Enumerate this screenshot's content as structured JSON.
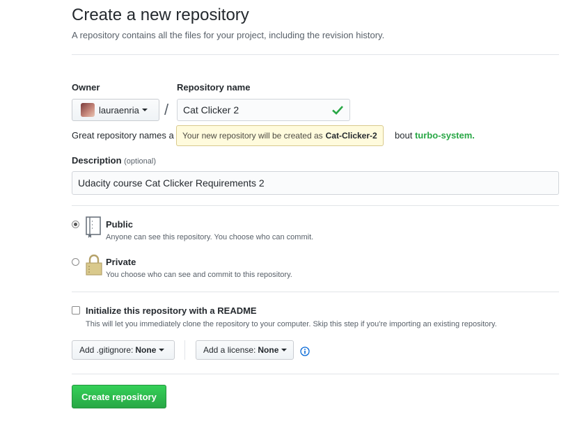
{
  "header": {
    "title": "Create a new repository",
    "subtitle": "A repository contains all the files for your project, including the revision history."
  },
  "owner": {
    "label": "Owner",
    "value": "lauraenria"
  },
  "repo": {
    "label": "Repository name",
    "value": "Cat Clicker 2",
    "separator": "/"
  },
  "hint": {
    "prefix": "Great repository names a",
    "suffix_pre": "bout",
    "suggestion": "turbo-system."
  },
  "tooltip": {
    "text": "Your new repository will be created as",
    "name": "Cat-Clicker-2"
  },
  "description": {
    "label": "Description",
    "optional": "(optional)",
    "value": "Udacity course Cat Clicker Requirements 2"
  },
  "visibility": {
    "public": {
      "title": "Public",
      "desc": "Anyone can see this repository. You choose who can commit.",
      "selected": true
    },
    "private": {
      "title": "Private",
      "desc": "You choose who can see and commit to this repository.",
      "selected": false
    }
  },
  "init": {
    "title": "Initialize this repository with a README",
    "desc": "This will let you immediately clone the repository to your computer. Skip this step if you're importing an existing repository.",
    "checked": false
  },
  "gitignore": {
    "label": "Add .gitignore:",
    "value": "None"
  },
  "license": {
    "label": "Add a license:",
    "value": "None"
  },
  "submit": {
    "label": "Create repository"
  },
  "colors": {
    "accent_green": "#28a745",
    "check_green": "#28a745",
    "info_blue": "#0366d6"
  }
}
